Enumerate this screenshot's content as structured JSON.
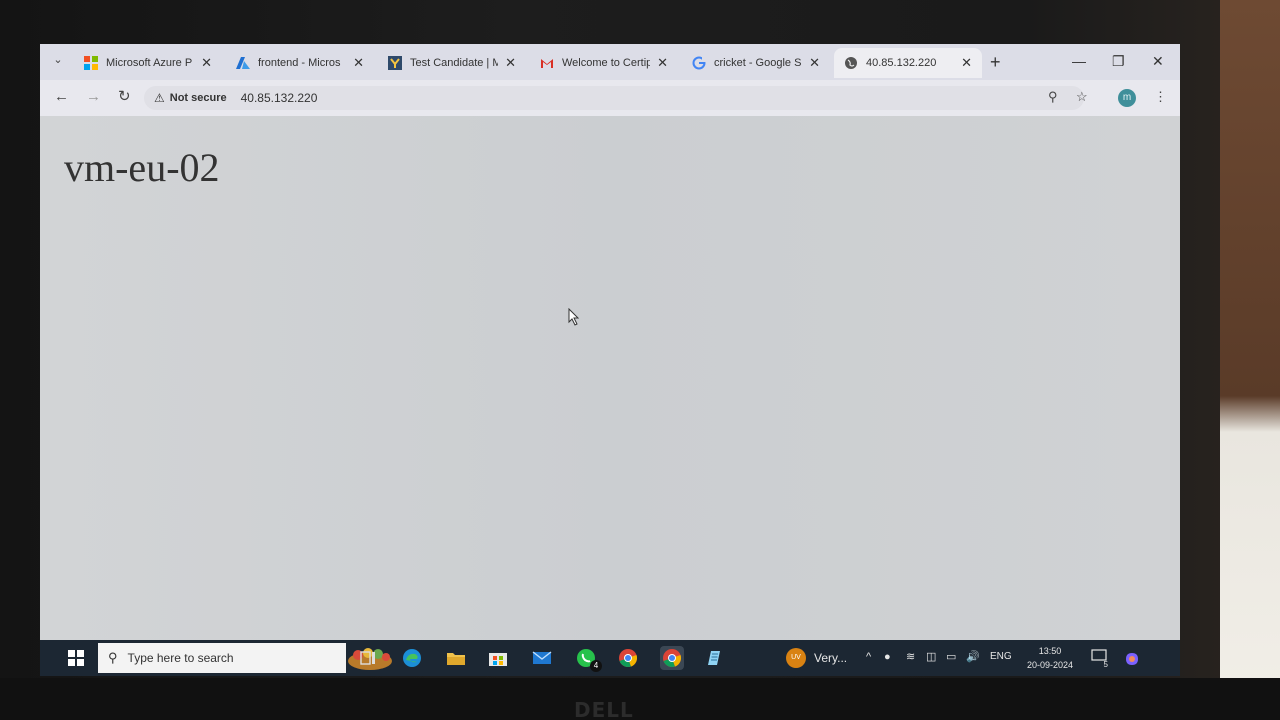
{
  "browser": {
    "tabs": [
      {
        "label": "Microsoft Azure P",
        "favicon": "microsoft-logo-icon",
        "active": false
      },
      {
        "label": "frontend - Micros",
        "favicon": "azure-logo-icon",
        "active": false
      },
      {
        "label": "Test Candidate | M",
        "favicon": "test-logo-icon",
        "active": false
      },
      {
        "label": "Welcome to Certip",
        "favicon": "gmail-icon",
        "active": false
      },
      {
        "label": "cricket - Google S",
        "favicon": "google-icon",
        "active": false
      },
      {
        "label": "40.85.132.220",
        "favicon": "globe-icon",
        "active": true
      }
    ],
    "address_bar": {
      "security_label": "Not secure",
      "url": "40.85.132.220"
    },
    "profile_initial": "m"
  },
  "page": {
    "heading": "vm-eu-02"
  },
  "taskbar": {
    "search_placeholder": "Type here to search",
    "whatsapp_badge": "4",
    "weather_avatar": "UV",
    "weather_label": "Very...",
    "language": "ENG",
    "time": "13:50",
    "date": "20-09-2024",
    "notification_count": "5"
  },
  "laptop": {
    "brand": "DELL"
  },
  "colors": {
    "taskbar_bg": "#1c2733",
    "tabbar_bg": "#dcdde7",
    "page_bg": "#cfd1d3",
    "weather_accent": "#d98212"
  }
}
